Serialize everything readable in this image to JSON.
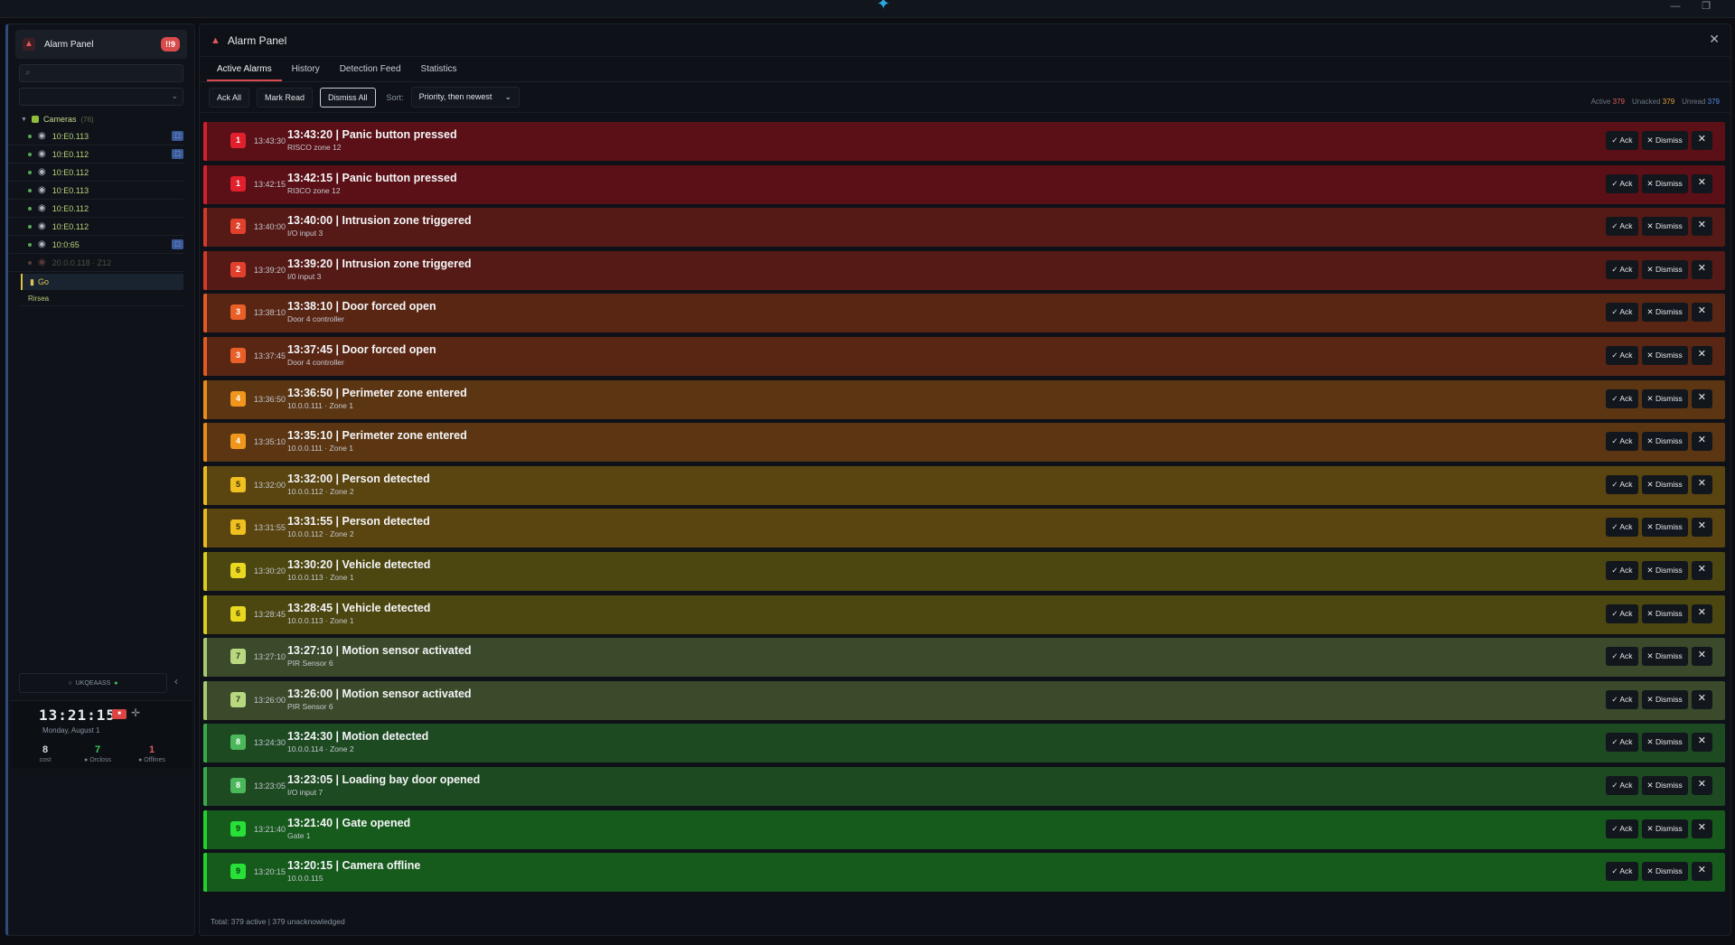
{
  "window": {
    "logo_icon": "✦",
    "minimize": "—",
    "restore": "❐"
  },
  "sidebar": {
    "title": "Alarm Panel",
    "badge": "!!9",
    "bell_icon": "bell-icon",
    "group": {
      "label": "Cameras",
      "count": "(76)"
    },
    "cameras": [
      {
        "ip": "10:E0.113",
        "tagged": true,
        "dim": false
      },
      {
        "ip": "10:E0.112",
        "tagged": true,
        "dim": false
      },
      {
        "ip": "10:E0.112",
        "tagged": false,
        "dim": false
      },
      {
        "ip": "10:E0.113",
        "tagged": false,
        "dim": false
      },
      {
        "ip": "10:E0.112",
        "tagged": false,
        "dim": false
      },
      {
        "ip": "10:E0.112",
        "tagged": false,
        "dim": false
      },
      {
        "ip": "10:0:65",
        "tagged": true,
        "dim": false
      },
      {
        "ip": "20.0.0.118 · Z12",
        "tagged": false,
        "dim": true
      }
    ],
    "go_label": "Go",
    "rirsea_label": "Rirsea",
    "user_label": "UKQEAASS",
    "user_status": "●",
    "clock": {
      "time": "13:21:15",
      "date": "Monday, August 1",
      "stats": [
        {
          "value": "8",
          "label": "cost",
          "color": "#e6e8ec"
        },
        {
          "value": "7",
          "label": "● Orcloss",
          "color": "#3acb5a"
        },
        {
          "value": "1",
          "label": "● Offlines",
          "color": "#e05a5a"
        }
      ]
    }
  },
  "main": {
    "title": "Alarm Panel",
    "close_icon": "✕",
    "tabs": [
      "Active Alarms",
      "History",
      "Detection Feed",
      "Statistics"
    ],
    "toolbar": {
      "ack_all": "Ack All",
      "mark_read": "Mark Read",
      "dismiss_all": "Dismiss All",
      "sort_label": "Sort:",
      "sort_value": "Priority, then newest"
    },
    "counters": {
      "active_label": "Active",
      "active": "379",
      "unacked_label": "Unacked",
      "unacked": "379",
      "unread_label": "Unread",
      "unread": "379"
    },
    "footer": "Total: 379 active  |  379 unacknowledged",
    "row_actions": {
      "ack": "✓ Ack",
      "dismiss": "✕ Dismiss",
      "close": "✕"
    }
  },
  "priority_colors": {
    "1": {
      "bg": "#5a1016",
      "border": "#d0202c",
      "chip": "#e0202c",
      "chip_text": "#ffffff"
    },
    "2": {
      "bg": "#561a16",
      "border": "#d03a28",
      "chip": "#e0402c",
      "chip_text": "#ffffff"
    },
    "3": {
      "bg": "#5a2614",
      "border": "#e05a24",
      "chip": "#e86028",
      "chip_text": "#ffffff"
    },
    "4": {
      "bg": "#5c3612",
      "border": "#e88a1c",
      "chip": "#f0961c",
      "chip_text": "#ffffff"
    },
    "5": {
      "bg": "#5a4410",
      "border": "#e8b81c",
      "chip": "#f0c020",
      "chip_text": "#3a2a00"
    },
    "6": {
      "bg": "#4c4610",
      "border": "#d8cc1c",
      "chip": "#e8d820",
      "chip_text": "#3a3400"
    },
    "7": {
      "bg": "#3a4a2a",
      "border": "#a8c870",
      "chip": "#b8d880",
      "chip_text": "#2a3a1a"
    },
    "8": {
      "bg": "#1e4a22",
      "border": "#3aa84a",
      "chip": "#4ab85a",
      "chip_text": "#ffffff"
    },
    "9": {
      "bg": "#165a1c",
      "border": "#22d030",
      "chip": "#28e038",
      "chip_text": "#0a3a0e"
    }
  },
  "alarms": [
    {
      "priority": "1",
      "time": "13:43:30",
      "title": "13:43:20 | Panic button pressed",
      "source": "RISCO zone 12"
    },
    {
      "priority": "1",
      "time": "13:42:15",
      "title": "13:42:15 | Panic button pressed",
      "source": "RI3CO zone 12"
    },
    {
      "priority": "2",
      "time": "13:40:00",
      "title": "13:40:00 | Intrusion zone triggered",
      "source": "I/O input 3"
    },
    {
      "priority": "2",
      "time": "13:39:20",
      "title": "13:39:20 | Intrusion zone triggered",
      "source": "I/0 input 3"
    },
    {
      "priority": "3",
      "time": "13:38:10",
      "title": "13:38:10 | Door forced open",
      "source": "Door 4 controller"
    },
    {
      "priority": "3",
      "time": "13:37:45",
      "title": "13:37:45 | Door forced open",
      "source": "Door 4 controller"
    },
    {
      "priority": "4",
      "time": "13:36:50",
      "title": "13:36:50 | Perimeter zone entered",
      "source": "10.0.0.111 · Zone 1"
    },
    {
      "priority": "4",
      "time": "13:35:10",
      "title": "13:35:10 | Perimeter zone entered",
      "source": "10.0.0.111 · Zone 1"
    },
    {
      "priority": "5",
      "time": "13:32:00",
      "title": "13:32:00 | Person detected",
      "source": "10.0.0.112 · Zone 2"
    },
    {
      "priority": "5",
      "time": "13:31:55",
      "title": "13:31:55 | Person detected",
      "source": "10.0.0.112 · Zone 2"
    },
    {
      "priority": "6",
      "time": "13:30:20",
      "title": "13:30:20 | Vehicle detected",
      "source": "10.0.0.113 · Zone 1"
    },
    {
      "priority": "6",
      "time": "13:28:45",
      "title": "13:28:45 | Vehicle detected",
      "source": "10.0.0.113 · Zone 1"
    },
    {
      "priority": "7",
      "time": "13:27:10",
      "title": "13:27:10 | Motion sensor activated",
      "source": "PIR Sensor 6"
    },
    {
      "priority": "7",
      "time": "13:26:00",
      "title": "13:26:00 | Motion sensor activated",
      "source": "PIR Sensor 6"
    },
    {
      "priority": "8",
      "time": "13:24:30",
      "title": "13:24:30 | Motion detected",
      "source": "10.0.0.114 · Zone 2"
    },
    {
      "priority": "8",
      "time": "13:23:05",
      "title": "13:23:05 | Loading bay door opened",
      "source": "I/O input 7"
    },
    {
      "priority": "9",
      "time": "13:21:40",
      "title": "13:21:40 | Gate opened",
      "source": "Gate 1"
    },
    {
      "priority": "9",
      "time": "13:20:15",
      "title": "13:20:15 | Camera offline",
      "source": "10.0.0.115"
    }
  ]
}
